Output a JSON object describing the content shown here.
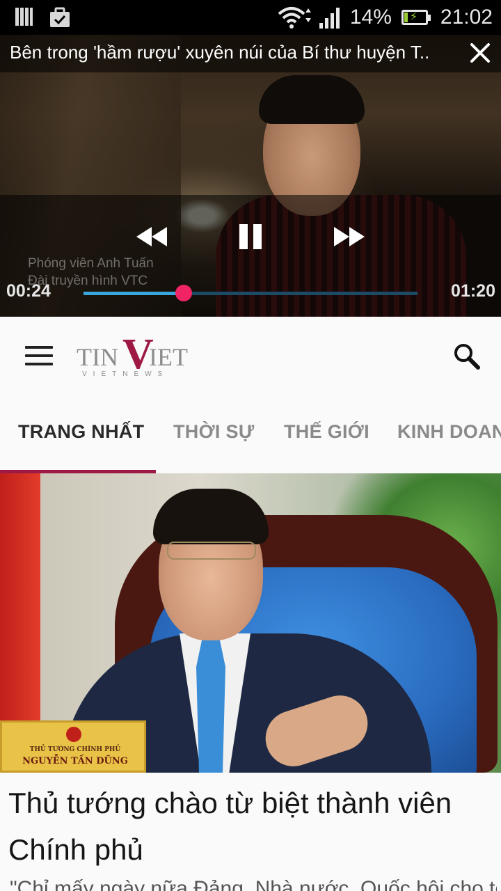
{
  "status_bar": {
    "battery_percent": "14%",
    "time": "21:02"
  },
  "video": {
    "title": "Bên trong 'hầm rượu' xuyên núi của Bí thư huyện T..",
    "caption_line1": "Phóng viên Anh Tuấn",
    "caption_line2": "Đài truyền hình VTC",
    "elapsed": "00:24",
    "duration": "01:20",
    "progress": 0.3
  },
  "header": {
    "logo_tin": "TIN",
    "logo_v": "V",
    "logo_iet": "IET",
    "logo_tagline": "VIETNEWS"
  },
  "tabs": [
    {
      "label": "TRANG NHẤT",
      "active": true
    },
    {
      "label": "THỜI SỰ",
      "active": false
    },
    {
      "label": "THẾ GIỚI",
      "active": false
    },
    {
      "label": "KINH DOAN",
      "active": false
    }
  ],
  "hero": {
    "nameplate_title": "THỦ TƯỚNG CHÍNH PHỦ",
    "nameplate_name": "NGUYỄN TẤN DŨNG"
  },
  "article": {
    "headline": "Thủ tướng chào từ biệt thành viên Chính phủ",
    "excerpt": "\"Chỉ mấy ngày nữa Đảng, Nhà nước, Quốc hội cho tôi"
  },
  "colors": {
    "accent": "#9e1a45",
    "seek_thumb": "#f02465",
    "seek_played": "#3aa7dc"
  }
}
